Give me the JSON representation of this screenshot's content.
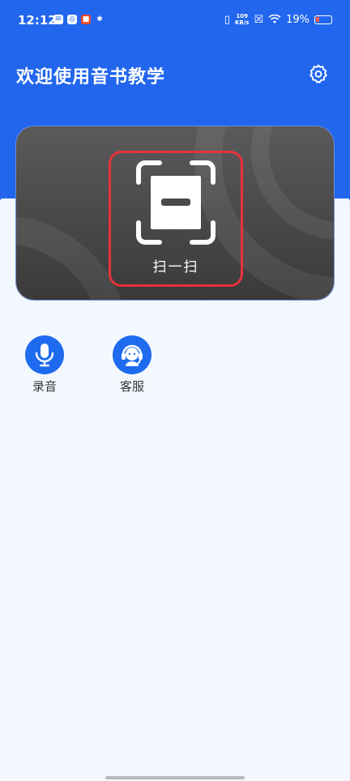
{
  "status_bar": {
    "time": "12:12",
    "net_speed_value": "109",
    "net_speed_unit": "KB/s",
    "battery_percent": "19%"
  },
  "header": {
    "title": "欢迎使用音书教学",
    "settings_icon": "gear-icon"
  },
  "scan": {
    "label": "扫一扫",
    "icon": "scan-frame-icon"
  },
  "features": [
    {
      "label": "录音",
      "icon": "microphone-icon"
    },
    {
      "label": "客服",
      "icon": "customer-service-headset-icon"
    }
  ],
  "colors": {
    "brand_blue": "#2266ee",
    "highlight_red": "#e8323a",
    "card_dark": "#444444",
    "background": "#f3f8fe"
  }
}
